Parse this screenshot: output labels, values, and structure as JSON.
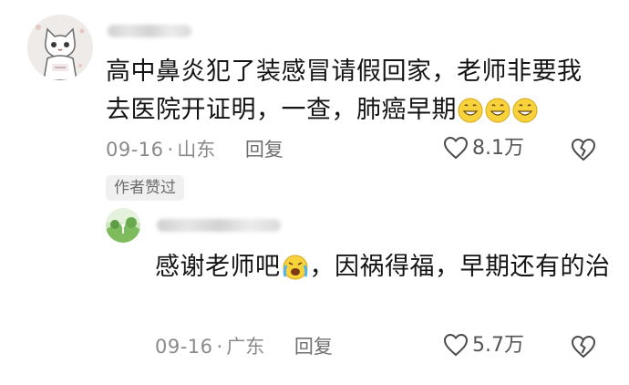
{
  "comments": [
    {
      "text_part1": "高中鼻炎犯了装感冒请假回家，老师非要我去医院开证明，一查，肺癌早期",
      "emojis": [
        "grin-emoji",
        "grin-emoji",
        "grin-emoji"
      ],
      "date": "09-16",
      "separator": "·",
      "location": "山东",
      "reply_label": "回复",
      "likes": "8.1万",
      "badge": "作者赞过"
    },
    {
      "text_part1": "感谢老师吧",
      "emoji": "crying-emoji",
      "text_part2": "，因祸得福，早期还有的治",
      "date": "09-16",
      "separator": "·",
      "location": "广东",
      "reply_label": "回复",
      "likes": "5.7万"
    }
  ],
  "colors": {
    "text": "#141414",
    "meta": "#8a8a8a",
    "badge_bg": "#f0f0f0",
    "emoji_yellow": "#f7d23a"
  }
}
